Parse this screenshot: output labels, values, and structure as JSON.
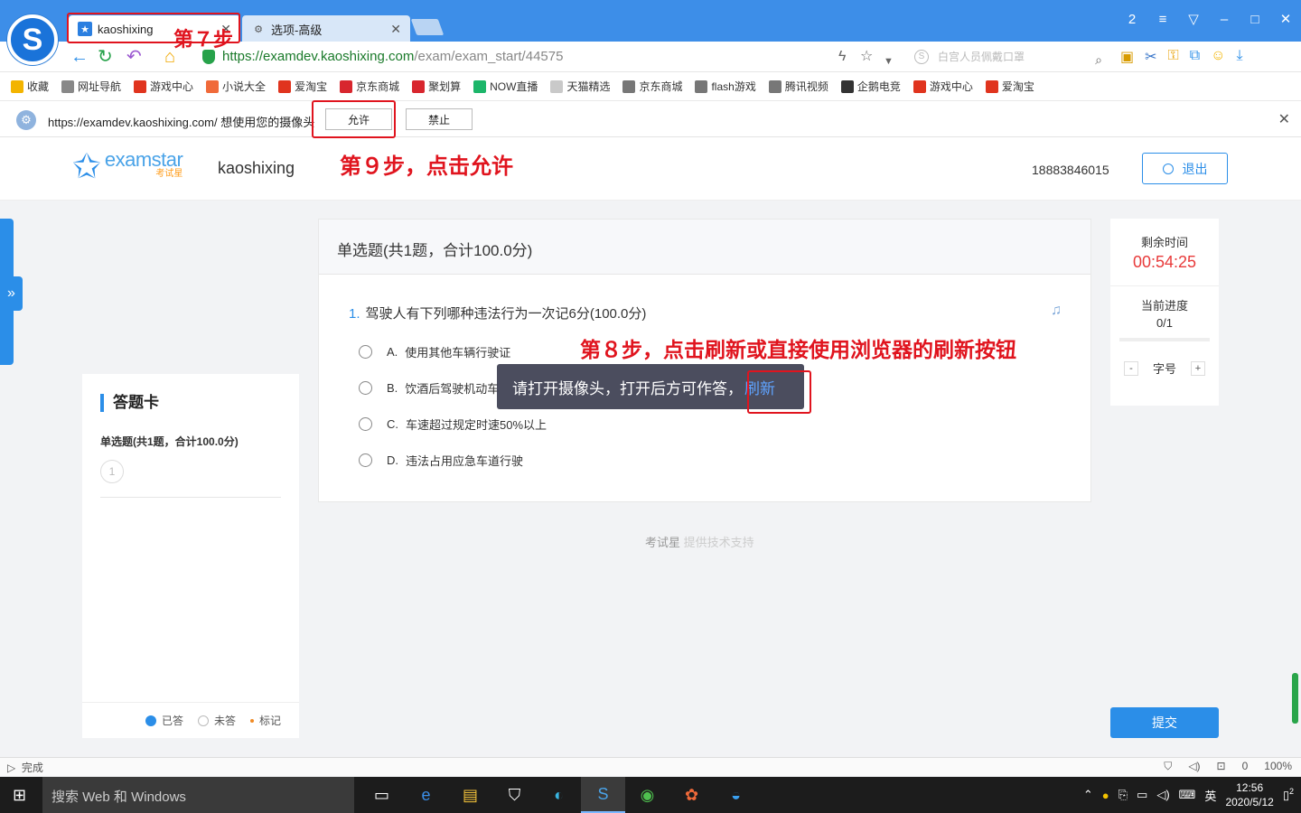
{
  "browser": {
    "tabs": [
      {
        "label": "kaoshixing",
        "active": true
      },
      {
        "label": "选项-高级",
        "active": false
      }
    ],
    "url": {
      "scheme": "https://",
      "host": "examdev.kaoshixing.com",
      "path": "/exam/exam_start/44575"
    },
    "search_placeholder": "白宫人员佩戴口罩",
    "window_buttons": [
      "2",
      "≡",
      "▽",
      "–",
      "□",
      "✕"
    ],
    "bookmarks": [
      {
        "label": "收藏",
        "icon": "star-icon",
        "color": "#f3b400"
      },
      {
        "label": "网址导航",
        "icon": "globe-icon",
        "color": "#888888"
      },
      {
        "label": "游戏中心",
        "icon": "game-icon",
        "color": "#e0341e"
      },
      {
        "label": "小说大全",
        "icon": "book-icon",
        "color": "#f06a3a"
      },
      {
        "label": "爱淘宝",
        "icon": "taobao-icon",
        "color": "#e0341e"
      },
      {
        "label": "京东商城",
        "icon": "jd-icon",
        "color": "#d8262e"
      },
      {
        "label": "聚划算",
        "icon": "juhuasuan-icon",
        "color": "#d8262e"
      },
      {
        "label": "NOW直播",
        "icon": "now-icon",
        "color": "#1cb66a"
      },
      {
        "label": "天猫精选",
        "icon": "tmall-icon",
        "color": "#c9c9c9"
      },
      {
        "label": "京东商城",
        "icon": "page-icon",
        "color": "#777777"
      },
      {
        "label": "flash游戏",
        "icon": "page-icon",
        "color": "#777777"
      },
      {
        "label": "腾讯视频",
        "icon": "page-icon",
        "color": "#777777"
      },
      {
        "label": "企鹅电竞",
        "icon": "penguin-icon",
        "color": "#333333"
      },
      {
        "label": "游戏中心",
        "icon": "gamepad-icon",
        "color": "#e0341e"
      },
      {
        "label": "爱淘宝",
        "icon": "taobao-icon",
        "color": "#e0341e"
      }
    ],
    "permission": {
      "text": "https://examdev.kaoshixing.com/ 想使用您的摄像头",
      "allow": "允许",
      "deny": "禁止"
    },
    "status": {
      "left": "完成",
      "shield": "",
      "counter": "0",
      "zoom": "100%"
    }
  },
  "annotations": {
    "step7": "第７步",
    "step8": "第８步，点击刷新或直接使用浏览器的刷新按钮",
    "step9": "第９步，点击允许",
    "color": "#e0141e"
  },
  "header": {
    "brand_en": "examstar",
    "brand_cn": "考试星",
    "site_name": "kaoshixing",
    "phone": "18883846015",
    "logout": "退出"
  },
  "answer_card": {
    "title": "答题卡",
    "section": "单选题(共1题，合计100.0分)",
    "numbers": [
      "1"
    ],
    "legend": {
      "answered": "已答",
      "unanswered": "未答",
      "marked": "标记"
    }
  },
  "question": {
    "section_header": "单选题(共1题，合计100.0分)",
    "number": "1.",
    "text": "驾驶人有下列哪种违法行为一次记6分(100.0分)",
    "options": [
      {
        "letter": "A.",
        "text": "使用其他车辆行驶证"
      },
      {
        "letter": "B.",
        "text": "饮酒后驾驶机动车"
      },
      {
        "letter": "C.",
        "text": "车速超过规定时速50%以上"
      },
      {
        "letter": "D.",
        "text": "违法占用应急车道行驶"
      }
    ]
  },
  "toast": {
    "message": "请打开摄像头，打开后方可作答，",
    "link": "刷新"
  },
  "footer": {
    "brand": "考试星",
    "support": "提供技术支持"
  },
  "timer": {
    "remaining_label": "剩余时间",
    "remaining": "00:54:25",
    "progress_label": "当前进度",
    "progress": "0/1",
    "progress_fraction": 0,
    "font_label": "字号",
    "minus": "-",
    "plus": "+"
  },
  "submit": "提交",
  "taskbar": {
    "search": "搜索 Web 和 Windows",
    "time": "12:56",
    "date": "2020/5/12",
    "lang": "英",
    "notif_count": "2"
  }
}
